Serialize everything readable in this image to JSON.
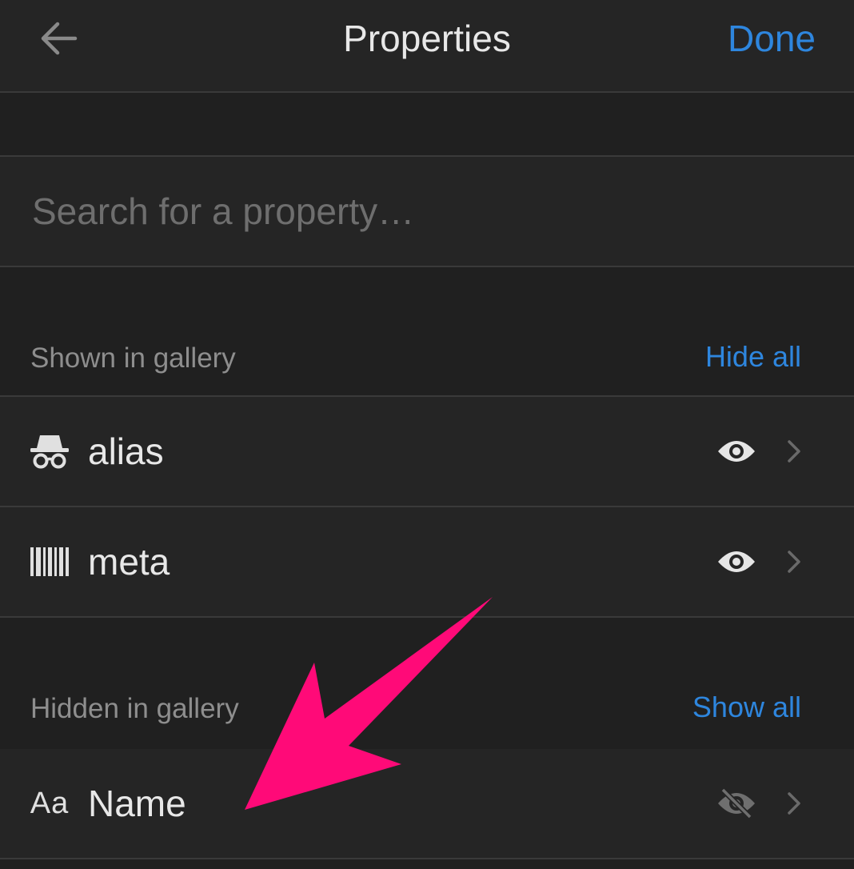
{
  "header": {
    "title": "Properties",
    "done_label": "Done",
    "back_icon": "arrow-left-icon"
  },
  "search": {
    "placeholder": "Search for a property…"
  },
  "shown_section": {
    "label": "Shown in gallery",
    "action_label": "Hide all",
    "items": [
      {
        "name": "alias",
        "icon": "incognito-icon",
        "visible": true
      },
      {
        "name": "meta",
        "icon": "barcode-icon",
        "visible": true
      }
    ]
  },
  "hidden_section": {
    "label": "Hidden in gallery",
    "action_label": "Show all",
    "items": [
      {
        "name": "Name",
        "icon_text": "Aa",
        "icon": "text-type-icon",
        "visible": false
      }
    ]
  },
  "colors": {
    "background": "#202020",
    "row": "#252525",
    "accent": "#2e86de",
    "annotation_arrow": "#ff0a78"
  }
}
